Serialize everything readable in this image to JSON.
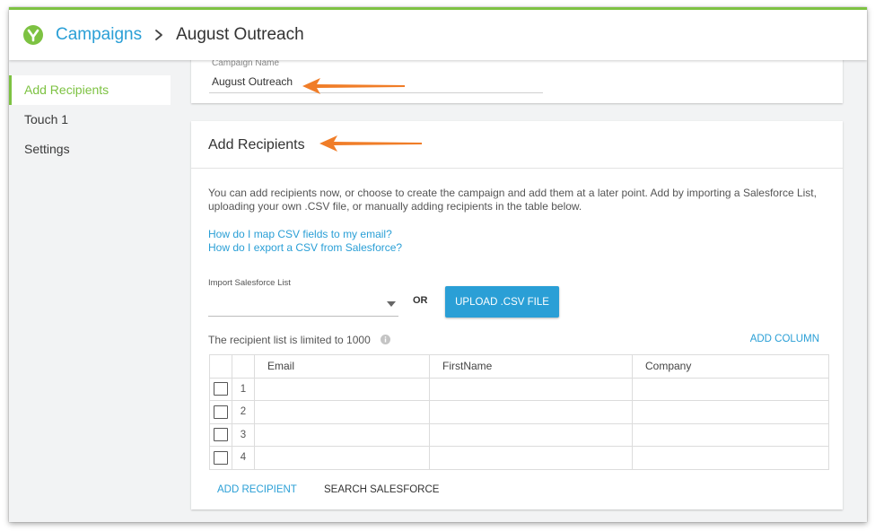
{
  "header": {
    "logo_icon": "vidyard-logo-icon",
    "breadcrumb_root": "Campaigns",
    "breadcrumb_separator_icon": "chevron-right-icon",
    "breadcrumb_current": "August Outreach",
    "accent_color": "#7dc242",
    "link_color": "#2a9fd6"
  },
  "sidebar": {
    "items": [
      {
        "label": "Add Recipients",
        "active": true
      },
      {
        "label": "Touch 1",
        "active": false
      },
      {
        "label": "Settings",
        "active": false
      }
    ]
  },
  "campaign_name": {
    "label": "Campaign Name",
    "value": "August Outreach"
  },
  "recipients": {
    "title": "Add Recipients",
    "intro": "You can add recipients now, or choose to create the campaign and add them at a later point. Add by importing a Salesforce List, uploading your own .CSV file, or manually adding recipients in the table below.",
    "help_links": [
      "How do I map CSV fields to my email?",
      "How do I export a CSV from Salesforce?"
    ],
    "import_label": "Import Salesforce List",
    "import_value": "",
    "or_text": "OR",
    "upload_button": "UPLOAD .CSV FILE",
    "limit_text": "The recipient list is limited to 1000",
    "add_column": "ADD COLUMN",
    "columns": [
      "Email",
      "FirstName",
      "Company"
    ],
    "rows": [
      {
        "num": "1",
        "email": "",
        "first_name": "",
        "company": ""
      },
      {
        "num": "2",
        "email": "",
        "first_name": "",
        "company": ""
      },
      {
        "num": "3",
        "email": "",
        "first_name": "",
        "company": ""
      },
      {
        "num": "4",
        "email": "",
        "first_name": "",
        "company": ""
      }
    ],
    "add_recipient": "ADD RECIPIENT",
    "search_salesforce": "SEARCH SALESFORCE"
  },
  "annotation_color": "#f07d28"
}
